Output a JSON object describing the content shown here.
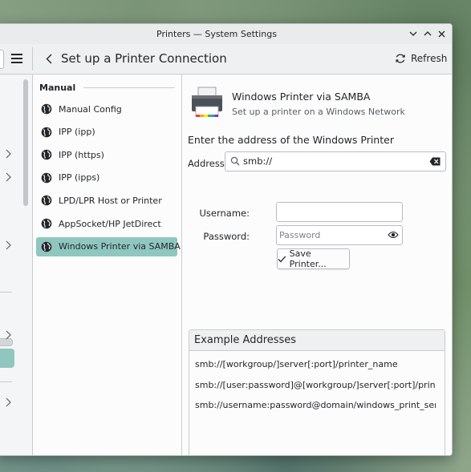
{
  "window": {
    "title": "Printers — System Settings"
  },
  "header": {
    "page_title": "Set up a Printer Connection",
    "refresh_label": "Refresh"
  },
  "list": {
    "section": "Manual",
    "items": [
      {
        "label": "Manual Config",
        "icon": "globe-icon"
      },
      {
        "label": "IPP (ipp)",
        "icon": "globe-icon"
      },
      {
        "label": "IPP (https)",
        "icon": "globe-icon"
      },
      {
        "label": "IPP (ipps)",
        "icon": "globe-icon"
      },
      {
        "label": "LPD/LPR Host or Printer",
        "icon": "globe-icon"
      },
      {
        "label": "AppSocket/HP JetDirect",
        "icon": "globe-icon"
      },
      {
        "label": "Windows Printer via SAMBA",
        "icon": "globe-icon",
        "selected": true
      }
    ]
  },
  "detail": {
    "printer_name": "Windows Printer via SAMBA",
    "printer_desc": "Set up a printer on a Windows Network",
    "enter_label": "Enter the address of the Windows Printer",
    "address_label": "Address:",
    "address_value": "smb://",
    "username_label": "Username:",
    "username_value": "",
    "password_label": "Password:",
    "password_placeholder": "Password",
    "save_label": "Save Printer..."
  },
  "examples": {
    "title": "Example Addresses",
    "rows": [
      "smb://[workgroup/]server[:port]/printer_name",
      "smb://[user:password]@[workgroup/]server[:port]/printer_n...",
      "smb://username:password@domain/windows_print_server_..."
    ]
  },
  "colors": {
    "accent": "#8fc7c0",
    "window_bg": "#fcfcfc",
    "header_bg": "#eff0f1"
  }
}
